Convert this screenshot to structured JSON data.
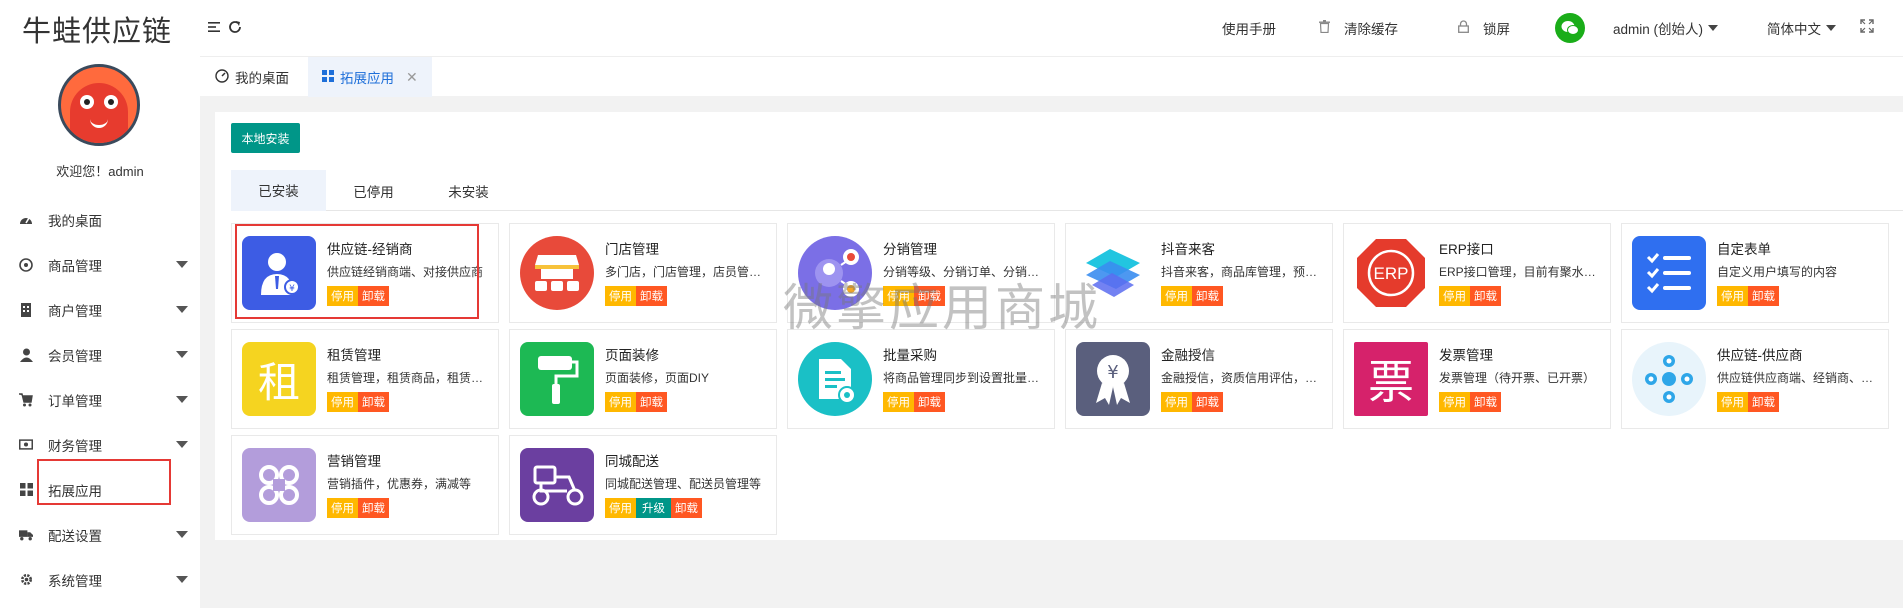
{
  "app": {
    "logo_text": "牛蛙供应链",
    "welcome": "欢迎您！admin"
  },
  "sidebar": {
    "items": [
      {
        "label": "我的桌面",
        "icon": "dashboard-icon",
        "has_caret": false
      },
      {
        "label": "商品管理",
        "icon": "goods-icon",
        "has_caret": true
      },
      {
        "label": "商户管理",
        "icon": "building-icon",
        "has_caret": true
      },
      {
        "label": "会员管理",
        "icon": "user-icon",
        "has_caret": true
      },
      {
        "label": "订单管理",
        "icon": "cart-icon",
        "has_caret": true
      },
      {
        "label": "财务管理",
        "icon": "money-icon",
        "has_caret": true
      },
      {
        "label": "拓展应用",
        "icon": "grid-icon",
        "has_caret": false,
        "active": true
      },
      {
        "label": "配送设置",
        "icon": "truck-icon",
        "has_caret": true
      },
      {
        "label": "系统管理",
        "icon": "gear-icon",
        "has_caret": true
      }
    ]
  },
  "header": {
    "manual": "使用手册",
    "clear_cache": "清除缓存",
    "lock": "锁屏",
    "user": "admin (创始人)",
    "language": "简体中文"
  },
  "page_tabs": [
    {
      "label": "我的桌面",
      "active": false
    },
    {
      "label": "拓展应用",
      "active": true
    }
  ],
  "toolbar": {
    "install_label": "本地安装"
  },
  "status_tabs": [
    "已安装",
    "已停用",
    "未安装"
  ],
  "buttons": {
    "stop": "停用",
    "uninstall": "卸载",
    "upgrade": "升级"
  },
  "apps": [
    {
      "name": "供应链-经销商",
      "desc": "供应链经销商端、对接供应商",
      "icon": "distributor-icon",
      "color": "#3d5ce4"
    },
    {
      "name": "门店管理",
      "desc": "多门店，门店管理，店员管理等",
      "icon": "store-icon",
      "color": "#e84a3a"
    },
    {
      "name": "分销管理",
      "desc": "分销等级、分销订单、分销商管理",
      "icon": "distribution-icon",
      "color": "#7b6fe6"
    },
    {
      "name": "抖音来客",
      "desc": "抖音来客，商品库管理，预约核销",
      "icon": "douyin-icon",
      "color": "#3aa5f5"
    },
    {
      "name": "ERP接口",
      "desc": "ERP接口管理，目前有聚水潭接口",
      "icon": "erp-icon",
      "color": "#e53b2c"
    },
    {
      "name": "自定表单",
      "desc": "自定义用户填写的内容",
      "icon": "form-icon",
      "color": "#2f6ff0"
    },
    {
      "name": "租赁管理",
      "desc": "租赁管理，租赁商品，租赁订单",
      "icon": "rent-icon",
      "color": "#f5d420"
    },
    {
      "name": "页面装修",
      "desc": "页面装修，页面DIY",
      "icon": "paint-roller-icon",
      "color": "#1db954"
    },
    {
      "name": "批量采购",
      "desc": "将商品管理同步到设置批量采购",
      "icon": "batch-purchase-icon",
      "color": "#1ac0c6"
    },
    {
      "name": "金融授信",
      "desc": "金融授信，资质信用评估，额度管理",
      "icon": "finance-icon",
      "color": "#5a5f7d"
    },
    {
      "name": "发票管理",
      "desc": "发票管理（待开票、已开票）",
      "icon": "invoice-icon",
      "color": "#d6226b"
    },
    {
      "name": "供应链-供应商",
      "desc": "供应链供应商端、经销商、订单",
      "icon": "supplier-icon",
      "color": "#2ea6e8"
    },
    {
      "name": "营销管理",
      "desc": "营销插件，优惠券，满减等",
      "icon": "marketing-icon",
      "color": "#b39ddb"
    },
    {
      "name": "同城配送",
      "desc": "同城配送管理、配送员管理等",
      "icon": "delivery-icon",
      "color": "#6b3fa0"
    }
  ],
  "rent_glyph": "租",
  "invoice_glyph": "票",
  "erp_glyph": "ERP",
  "yen_glyph": "¥",
  "watermark": "微擎应用商城"
}
